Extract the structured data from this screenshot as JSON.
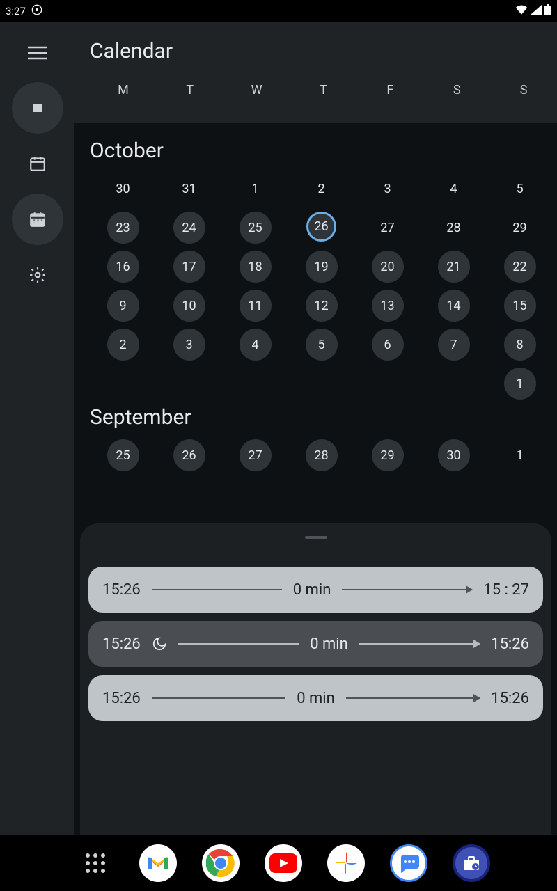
{
  "status": {
    "time": "3:27"
  },
  "header": {
    "title": "Calendar"
  },
  "weekdays": [
    "M",
    "T",
    "W",
    "T",
    "F",
    "S",
    "S"
  ],
  "months": [
    {
      "label": "October",
      "weeks": [
        [
          {
            "n": "30"
          },
          {
            "n": "31"
          },
          {
            "n": "1"
          },
          {
            "n": "2"
          },
          {
            "n": "3"
          },
          {
            "n": "4"
          },
          {
            "n": "5"
          }
        ],
        [
          {
            "n": "23",
            "has": true
          },
          {
            "n": "24",
            "has": true
          },
          {
            "n": "25",
            "has": true
          },
          {
            "n": "26",
            "has": true,
            "today": true
          },
          {
            "n": "27"
          },
          {
            "n": "28"
          },
          {
            "n": "29"
          }
        ],
        [
          {
            "n": "16",
            "has": true
          },
          {
            "n": "17",
            "has": true
          },
          {
            "n": "18",
            "has": true
          },
          {
            "n": "19",
            "has": true
          },
          {
            "n": "20",
            "has": true
          },
          {
            "n": "21",
            "has": true
          },
          {
            "n": "22",
            "has": true
          }
        ],
        [
          {
            "n": "9",
            "has": true
          },
          {
            "n": "10",
            "has": true
          },
          {
            "n": "11",
            "has": true
          },
          {
            "n": "12",
            "has": true
          },
          {
            "n": "13",
            "has": true
          },
          {
            "n": "14",
            "has": true
          },
          {
            "n": "15",
            "has": true
          }
        ],
        [
          {
            "n": "2",
            "has": true
          },
          {
            "n": "3",
            "has": true
          },
          {
            "n": "4",
            "has": true
          },
          {
            "n": "5",
            "has": true
          },
          {
            "n": "6",
            "has": true
          },
          {
            "n": "7",
            "has": true
          },
          {
            "n": "8",
            "has": true
          }
        ],
        [
          {
            "n": ""
          },
          {
            "n": ""
          },
          {
            "n": ""
          },
          {
            "n": ""
          },
          {
            "n": ""
          },
          {
            "n": ""
          },
          {
            "n": "1",
            "has": true
          }
        ]
      ]
    },
    {
      "label": "September",
      "weeks": [
        [
          {
            "n": "25",
            "has": true
          },
          {
            "n": "26",
            "has": true
          },
          {
            "n": "27",
            "has": true
          },
          {
            "n": "28",
            "has": true
          },
          {
            "n": "29",
            "has": true
          },
          {
            "n": "30",
            "has": true
          },
          {
            "n": "1"
          }
        ]
      ]
    }
  ],
  "entries": [
    {
      "start": "15:26",
      "duration": "0 min",
      "end": "15 : 27",
      "style": "light",
      "moon": false
    },
    {
      "start": "15:26",
      "duration": "0 min",
      "end": "15:26",
      "style": "dark",
      "moon": true
    },
    {
      "start": "15:26",
      "duration": "0 min",
      "end": "15:26",
      "style": "light",
      "moon": false
    }
  ],
  "nav": {
    "apps": [
      "drawer",
      "gmail",
      "chrome",
      "youtube",
      "photos",
      "messages",
      "work"
    ]
  }
}
